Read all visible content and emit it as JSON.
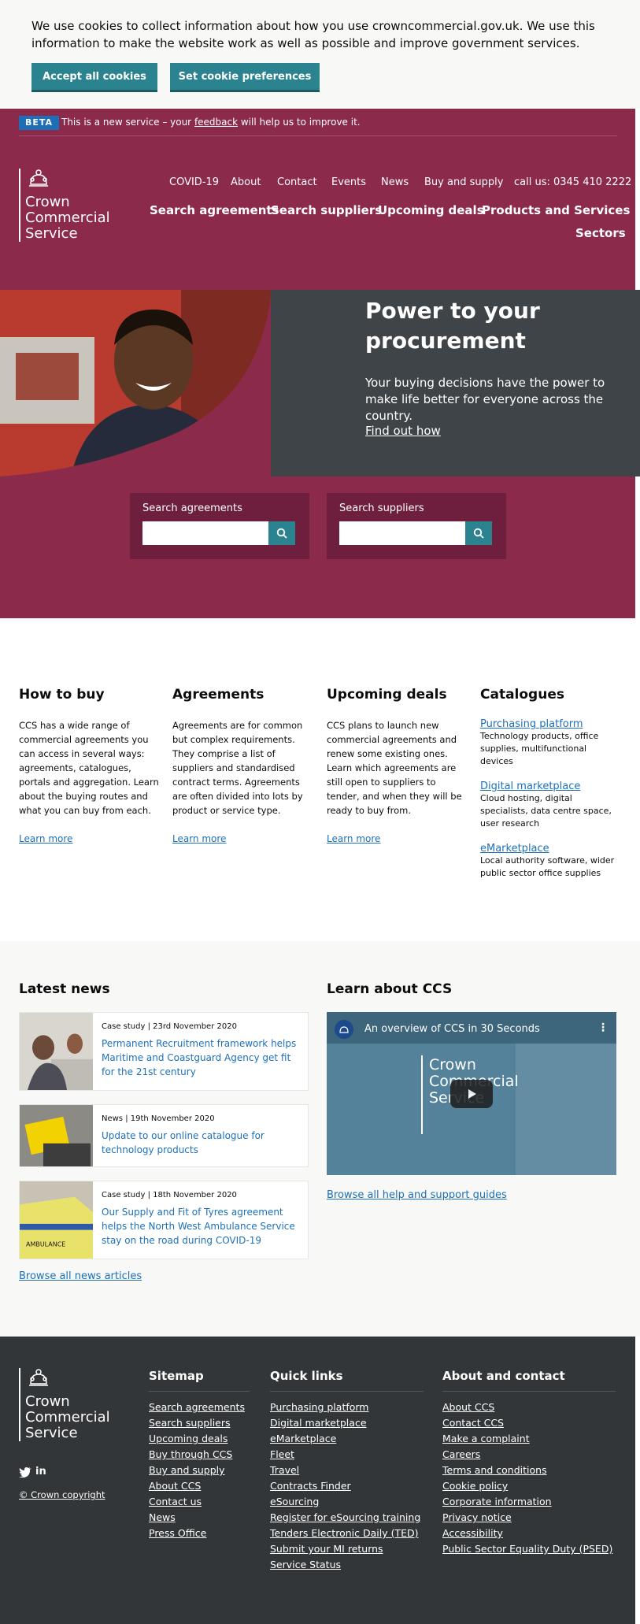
{
  "cookie": {
    "text": "We use cookies to collect information about how you use crowncommercial.gov.uk. We use this information to make the website work as well as possible and improve government services.",
    "accept_label": "Accept all cookies",
    "prefs_label": "Set cookie preferences"
  },
  "beta": {
    "tag": "BETA",
    "text_before": "This is a new service – your ",
    "link": "feedback",
    "text_after": " will help us to improve it."
  },
  "logo": {
    "line1": "Crown",
    "line2": "Commercial",
    "line3": "Service"
  },
  "top_nav": [
    "COVID-19",
    "About",
    "Contact",
    "Events",
    "News",
    "Buy and supply"
  ],
  "phone": "call us: 0345 410 2222",
  "main_nav": [
    "Search agreements",
    "Search suppliers",
    "Upcoming deals",
    "Products and Services",
    "Sectors"
  ],
  "hero": {
    "title": "Power to your procurement",
    "subtitle": "Your buying decisions have the power to make life better for everyone across the country.",
    "link": "Find out how"
  },
  "search": {
    "agreements_label": "Search agreements",
    "suppliers_label": "Search suppliers"
  },
  "columns": {
    "how_to_buy": {
      "title": "How to buy",
      "text": "CCS has a wide range of commercial agreements you can access in several ways: agreements, catalogues, portals and aggregation. Learn about the buying routes and what you can buy from each.",
      "link": "Learn more"
    },
    "agreements": {
      "title": "Agreements",
      "text": "Agreements are for common but complex requirements. They comprise a list of suppliers and standardised contract terms. Agreements are often divided into lots by product or service type.",
      "link": "Learn more"
    },
    "upcoming": {
      "title": "Upcoming deals",
      "text": "CCS plans to launch new commercial agreements and renew some existing ones. Learn which agreements are still open to suppliers to tender, and when they will be ready to buy from.",
      "link": "Learn more"
    },
    "catalogues": {
      "title": "Catalogues",
      "items": [
        {
          "link": "Purchasing platform",
          "desc": "Technology products, office supplies, multifunctional devices"
        },
        {
          "link": "Digital marketplace",
          "desc": "Cloud hosting, digital specialists, data centre space, user research"
        },
        {
          "link": "eMarketplace",
          "desc": "Local authority software, wider public sector office supplies"
        }
      ]
    }
  },
  "news": {
    "title": "Latest news",
    "items": [
      {
        "meta": "Case study | 23rd November 2020",
        "title": "Permanent Recruitment framework helps Maritime and Coastguard Agency get fit for the 21st century"
      },
      {
        "meta": "News | 19th November 2020",
        "title": "Update to our online catalogue for technology products"
      },
      {
        "meta": "Case study | 18th November 2020",
        "title": "Our Supply and Fit of Tyres agreement helps the North West Ambulance Service stay on the road during COVID-19"
      }
    ],
    "browse": "Browse all news articles",
    "ambulance_text": "AMBULANCE"
  },
  "learn": {
    "title": "Learn about CCS",
    "video_title": "An overview of CCS in 30 Seconds",
    "browse": "Browse all help and support guides"
  },
  "footer": {
    "copyright": "© Crown copyright",
    "sitemap": {
      "title": "Sitemap",
      "links": [
        "Search agreements",
        "Search suppliers",
        "Upcoming deals",
        "Buy through CCS",
        "Buy and supply",
        "About CCS",
        "Contact us",
        "News",
        "Press Office"
      ]
    },
    "quick": {
      "title": "Quick links",
      "links": [
        "Purchasing platform",
        "Digital marketplace",
        "eMarketplace",
        "Fleet",
        "Travel",
        "Contracts Finder",
        "eSourcing",
        "Register for eSourcing training",
        "Tenders Electronic Daily (TED)",
        "Submit your MI returns",
        "Service Status"
      ]
    },
    "about": {
      "title": "About and contact",
      "links": [
        "About CCS",
        "Contact CCS",
        "Make a complaint",
        "Careers",
        "Terms and conditions",
        "Cookie policy",
        "Corporate information",
        "Privacy notice",
        "Accessibility",
        "Public Sector Equality Duty (PSED)"
      ]
    }
  },
  "colors": {
    "brand": "#8c2a4c",
    "teal": "#2c8390",
    "dark": "#333638",
    "link": "#1d70b8"
  }
}
